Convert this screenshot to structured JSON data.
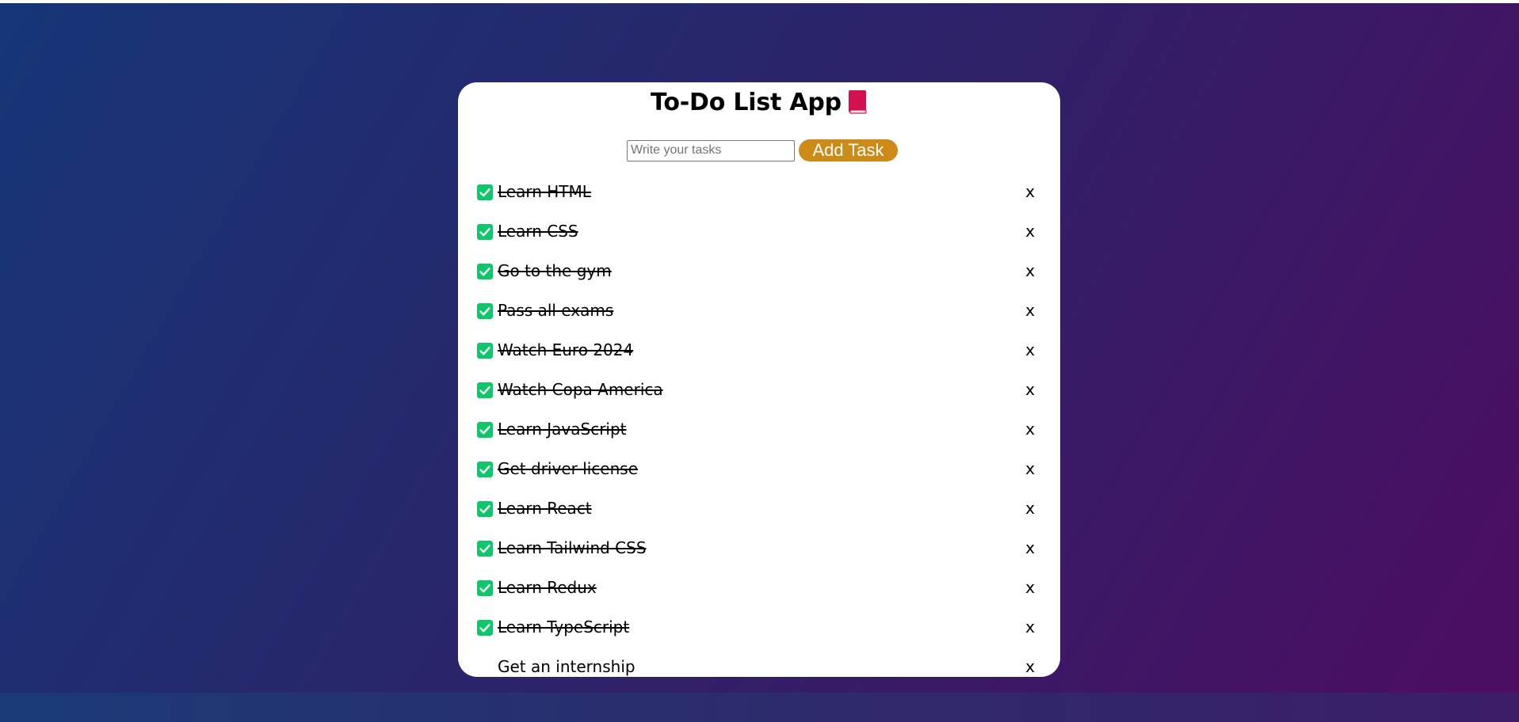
{
  "app": {
    "title": "To-Do List App",
    "title_emoji_icon": "closed-book-icon"
  },
  "form": {
    "input_value": "",
    "input_placeholder": "Write your tasks",
    "add_button_label": "Add Task"
  },
  "colors": {
    "background_gradient": [
      "#163677",
      "#2d2269",
      "#4d0d62"
    ],
    "card": "#ffffff",
    "accent_button": "#cd8a17",
    "checkbox_checked": "#0fc76a",
    "book_icon": "#d3114f"
  },
  "tasks": [
    {
      "text": "Learn HTML",
      "done": true,
      "delete_label": "x"
    },
    {
      "text": "Learn CSS",
      "done": true,
      "delete_label": "x"
    },
    {
      "text": "Go to the gym",
      "done": true,
      "delete_label": "x"
    },
    {
      "text": "Pass all exams",
      "done": true,
      "delete_label": "x"
    },
    {
      "text": "Watch Euro 2024",
      "done": true,
      "delete_label": "x"
    },
    {
      "text": "Watch Copa America",
      "done": true,
      "delete_label": "x"
    },
    {
      "text": "Learn JavaScript",
      "done": true,
      "delete_label": "x"
    },
    {
      "text": "Get driver license",
      "done": true,
      "delete_label": "x"
    },
    {
      "text": "Learn React",
      "done": true,
      "delete_label": "x"
    },
    {
      "text": "Learn Tailwind CSS",
      "done": true,
      "delete_label": "x"
    },
    {
      "text": "Learn Redux",
      "done": true,
      "delete_label": "x"
    },
    {
      "text": "Learn TypeScript",
      "done": true,
      "delete_label": "x"
    },
    {
      "text": "Get an internship",
      "done": false,
      "delete_label": "x"
    }
  ]
}
